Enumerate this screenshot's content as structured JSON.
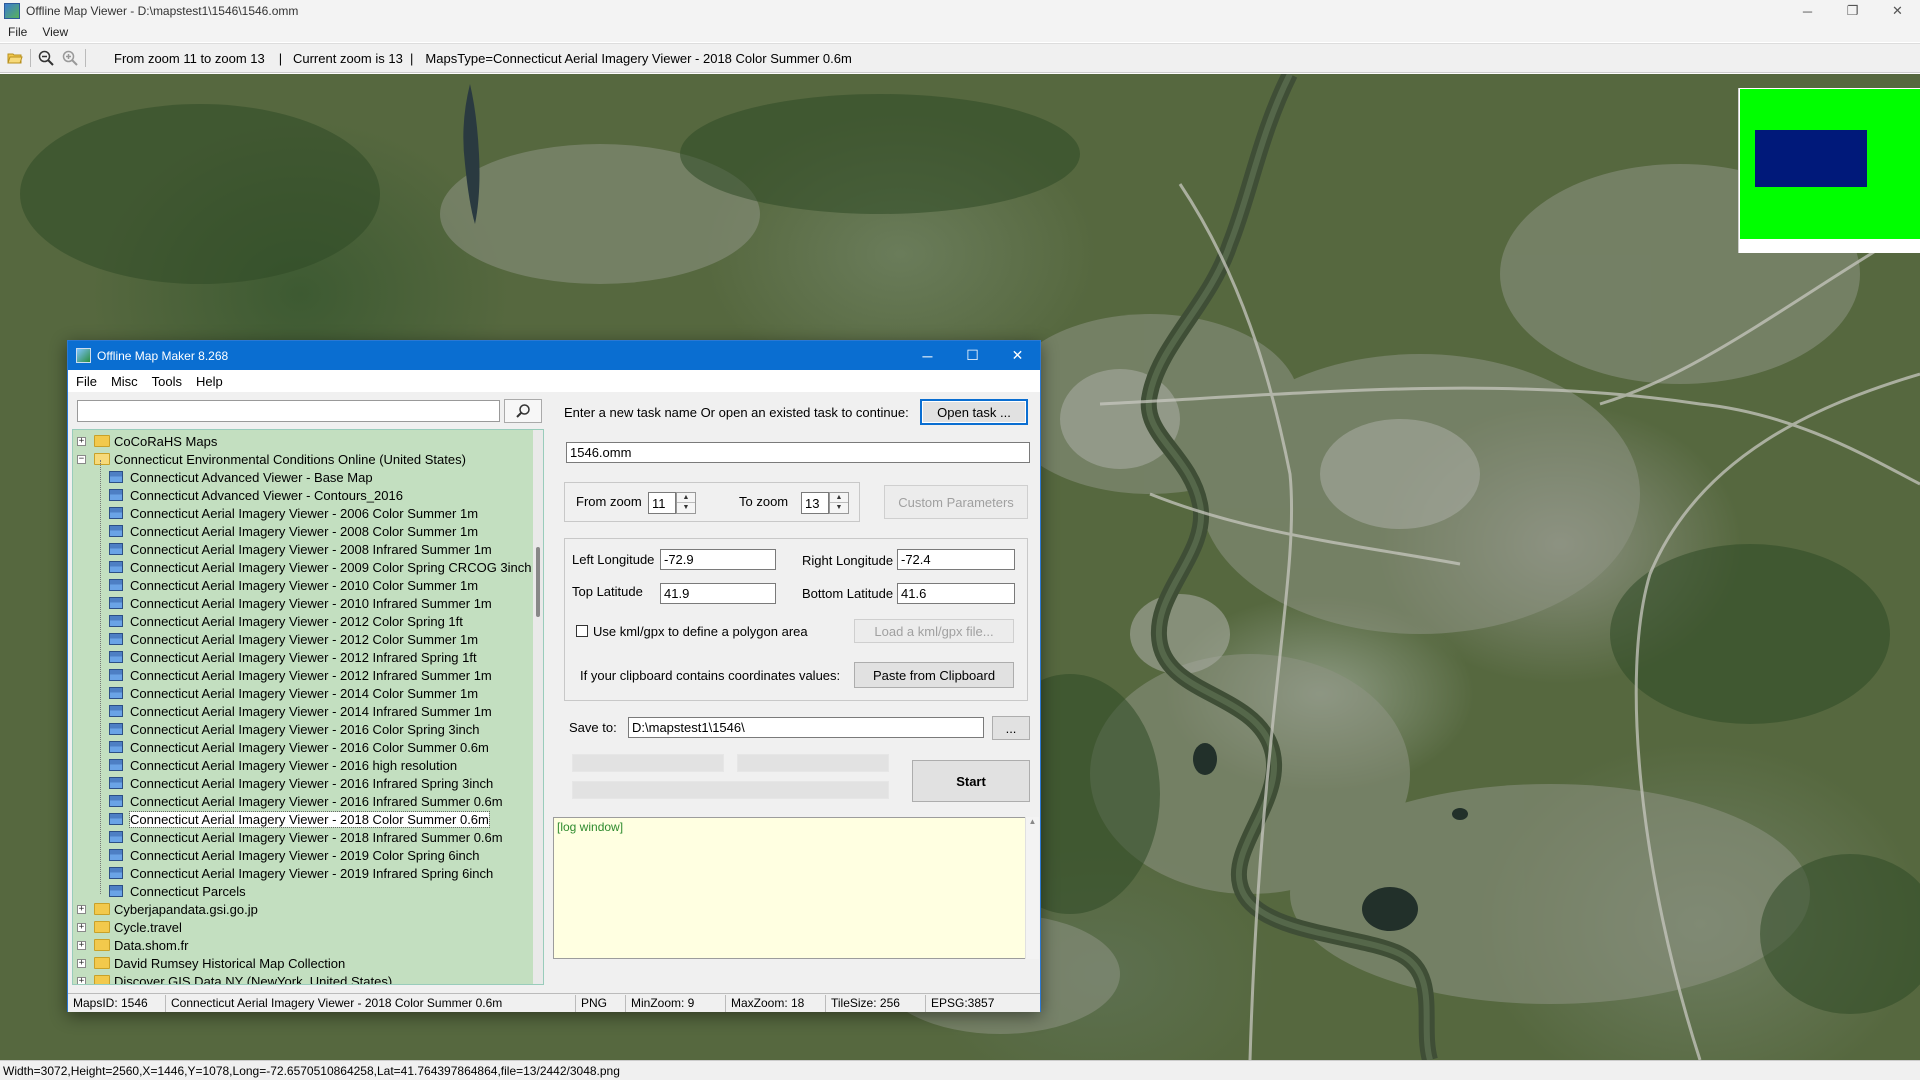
{
  "window": {
    "title": "Offline Map Viewer - D:\\mapstest1\\1546\\1546.omm",
    "minimize": "─",
    "restore": "❐",
    "close": "✕"
  },
  "menu": {
    "file": "File",
    "view": "View"
  },
  "toolbar": {
    "zoom_range": "From zoom 11 to zoom 13",
    "current_zoom": "|   Current zoom is 13  |",
    "maps_type": "MapsType=Connecticut Aerial Imagery Viewer - 2018 Color Summer 0.6m"
  },
  "status_bar": "Width=3072,Height=2560,X=1446,Y=1078,Long=-72.6570510864258,Lat=41.764397864864,file=13/2442/3048.png",
  "minimap": {
    "overview_color": "#00ff00",
    "viewport_color": "#00197a"
  },
  "dialog": {
    "title": "Offline Map Maker 8.268",
    "menu": [
      "File",
      "Misc",
      "Tools",
      "Help"
    ],
    "search": {
      "value": "",
      "placeholder": ""
    },
    "tree": {
      "items": [
        {
          "label": "CoCoRaHS Maps",
          "type": "folder",
          "level": 0,
          "expander": "+"
        },
        {
          "label": "Connecticut Environmental Conditions Online (United States)",
          "type": "folder-open",
          "level": 0,
          "expander": "−"
        },
        {
          "label": "Connecticut Advanced Viewer - Base Map",
          "type": "map",
          "level": 1
        },
        {
          "label": "Connecticut Advanced Viewer - Contours_2016",
          "type": "map",
          "level": 1
        },
        {
          "label": "Connecticut Aerial Imagery Viewer - 2006 Color Summer 1m",
          "type": "map",
          "level": 1
        },
        {
          "label": "Connecticut Aerial Imagery Viewer - 2008 Color Summer 1m",
          "type": "map",
          "level": 1
        },
        {
          "label": "Connecticut Aerial Imagery Viewer - 2008 Infrared Summer 1m",
          "type": "map",
          "level": 1
        },
        {
          "label": "Connecticut Aerial Imagery Viewer - 2009 Color Spring CRCOG 3inch",
          "type": "map",
          "level": 1
        },
        {
          "label": "Connecticut Aerial Imagery Viewer - 2010 Color Summer 1m",
          "type": "map",
          "level": 1
        },
        {
          "label": "Connecticut Aerial Imagery Viewer - 2010 Infrared Summer 1m",
          "type": "map",
          "level": 1
        },
        {
          "label": "Connecticut Aerial Imagery Viewer - 2012 Color Spring 1ft",
          "type": "map",
          "level": 1
        },
        {
          "label": "Connecticut Aerial Imagery Viewer - 2012 Color Summer 1m",
          "type": "map",
          "level": 1
        },
        {
          "label": "Connecticut Aerial Imagery Viewer - 2012 Infrared Spring 1ft",
          "type": "map",
          "level": 1
        },
        {
          "label": "Connecticut Aerial Imagery Viewer - 2012 Infrared Summer 1m",
          "type": "map",
          "level": 1
        },
        {
          "label": "Connecticut Aerial Imagery Viewer - 2014 Color Summer 1m",
          "type": "map",
          "level": 1
        },
        {
          "label": "Connecticut Aerial Imagery Viewer - 2014 Infrared Summer 1m",
          "type": "map",
          "level": 1
        },
        {
          "label": "Connecticut Aerial Imagery Viewer - 2016 Color Spring 3inch",
          "type": "map",
          "level": 1
        },
        {
          "label": "Connecticut Aerial Imagery Viewer - 2016 Color Summer 0.6m",
          "type": "map",
          "level": 1
        },
        {
          "label": "Connecticut Aerial Imagery Viewer - 2016 high resolution",
          "type": "map",
          "level": 1
        },
        {
          "label": "Connecticut Aerial Imagery Viewer - 2016 Infrared Spring 3inch",
          "type": "map",
          "level": 1
        },
        {
          "label": "Connecticut Aerial Imagery Viewer - 2016 Infrared Summer 0.6m",
          "type": "map",
          "level": 1
        },
        {
          "label": "Connecticut Aerial Imagery Viewer - 2018 Color Summer 0.6m",
          "type": "map",
          "level": 1,
          "selected": true
        },
        {
          "label": "Connecticut Aerial Imagery Viewer - 2018 Infrared Summer 0.6m",
          "type": "map",
          "level": 1
        },
        {
          "label": "Connecticut Aerial Imagery Viewer - 2019 Color Spring 6inch",
          "type": "map",
          "level": 1
        },
        {
          "label": "Connecticut Aerial Imagery Viewer - 2019 Infrared Spring 6inch",
          "type": "map",
          "level": 1
        },
        {
          "label": "Connecticut Parcels",
          "type": "map",
          "level": 1
        },
        {
          "label": "Cyberjapandata.gsi.go.jp",
          "type": "folder",
          "level": 0,
          "expander": "+"
        },
        {
          "label": "Cycle.travel",
          "type": "folder",
          "level": 0,
          "expander": "+"
        },
        {
          "label": "Data.shom.fr",
          "type": "folder",
          "level": 0,
          "expander": "+"
        },
        {
          "label": "David Rumsey Historical Map Collection",
          "type": "folder",
          "level": 0,
          "expander": "+"
        },
        {
          "label": "Discover GIS Data NY (NewYork, United States)",
          "type": "folder",
          "level": 0,
          "expander": "+"
        }
      ]
    },
    "task_prompt": "Enter a new task name Or open an existed task to continue:",
    "open_task_label": "Open task ...",
    "task_name": "1546.omm",
    "from_zoom_label": "From zoom",
    "from_zoom_value": "11",
    "to_zoom_label": "To zoom",
    "to_zoom_value": "13",
    "custom_params_label": "Custom Parameters",
    "left_lon_label": "Left Longitude",
    "left_lon_value": "-72.9",
    "right_lon_label": "Right Longitude",
    "right_lon_value": "-72.4",
    "top_lat_label": "Top Latitude",
    "top_lat_value": "41.9",
    "bottom_lat_label": "Bottom Latitude",
    "bottom_lat_value": "41.6",
    "kml_checkbox_label": "Use kml/gpx to define a polygon area",
    "kml_checked": false,
    "load_kml_label": "Load a kml/gpx file...",
    "clipboard_prompt": "If your clipboard contains coordinates values:",
    "paste_label": "Paste from Clipboard",
    "save_to_label": "Save to:",
    "save_to_value": "D:\\mapstest1\\1546\\",
    "browse_label": "...",
    "start_label": "Start",
    "log_text": "[log window]",
    "status": {
      "maps_id": "MapsID: 1546",
      "maps_name": "Connecticut Aerial Imagery Viewer - 2018 Color Summer 0.6m",
      "format": "PNG",
      "min_zoom": "MinZoom: 9",
      "max_zoom": "MaxZoom: 18",
      "tile_size": "TileSize: 256",
      "epsg": "EPSG:3857"
    }
  }
}
